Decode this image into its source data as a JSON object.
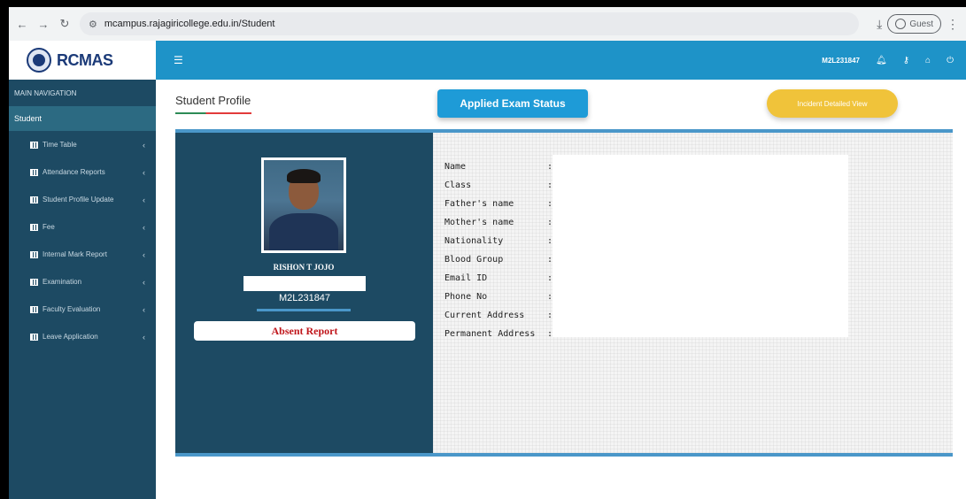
{
  "browser": {
    "url": "mcampus.rajagiricollege.edu.in/Student",
    "profile_label": "Guest"
  },
  "header": {
    "logo_name": "RCMAS",
    "user_code": "M2L231847"
  },
  "sidebar": {
    "section_title": "MAIN NAVIGATION",
    "active_section": "Student",
    "items": [
      {
        "label": "Time Table"
      },
      {
        "label": "Attendance Reports"
      },
      {
        "label": "Student Profile Update"
      },
      {
        "label": "Fee"
      },
      {
        "label": "Internal Mark Report"
      },
      {
        "label": "Examination"
      },
      {
        "label": "Faculty Evaluation"
      },
      {
        "label": "Leave Application"
      }
    ]
  },
  "main": {
    "page_title": "Student Profile",
    "applied_exam_button": "Applied Exam Status",
    "incident_button": "Incident Detailed View",
    "student_name": "RISHON T JOJO",
    "student_code": "M2L231847",
    "absent_report_button": "Absent Report",
    "fields": [
      {
        "label": "Name"
      },
      {
        "label": "Class"
      },
      {
        "label": "Father's name"
      },
      {
        "label": "Mother's name"
      },
      {
        "label": "Nationality"
      },
      {
        "label": "Blood Group"
      },
      {
        "label": "Email ID"
      },
      {
        "label": "Phone No"
      },
      {
        "label": "Current Address"
      },
      {
        "label": "Permanent Address"
      }
    ]
  },
  "colors": {
    "topbar": "#1e93c8",
    "sidebar": "#1d4a63",
    "exam_button": "#1e9bd7",
    "incident_button": "#f0c33a",
    "absent_text": "#c0161b"
  }
}
